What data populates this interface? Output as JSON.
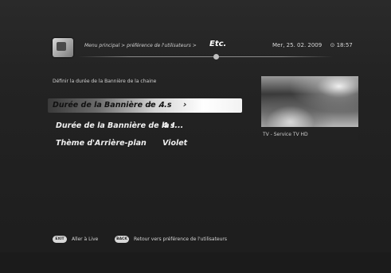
{
  "header": {
    "breadcrumb": "Menu principal > préférence de l'utilisateurs >",
    "current": "Etc.",
    "date": "Mer, 25. 02. 2009",
    "time": "18:57"
  },
  "description": "Définir la durée de la Bannière de la chaine",
  "menu": {
    "items": [
      {
        "label": "Durée de la Bannière de ...",
        "value": "4 s"
      },
      {
        "label": "Durée de la Bannière de la I...",
        "value": "4 s"
      },
      {
        "label": "Thème d'Arrière-plan",
        "value": "Violet"
      }
    ]
  },
  "preview": {
    "caption": "TV - Service TV HD"
  },
  "footer": {
    "exit_key": "EXIT",
    "exit_label": "Aller à Live",
    "back_key": "BACK",
    "back_label": "Retour vers préférence de l'utilisateurs"
  },
  "icons": {
    "app": "tv-icon",
    "clock": "clock-icon",
    "left": "chevron-left-icon",
    "right": "chevron-right-icon"
  }
}
